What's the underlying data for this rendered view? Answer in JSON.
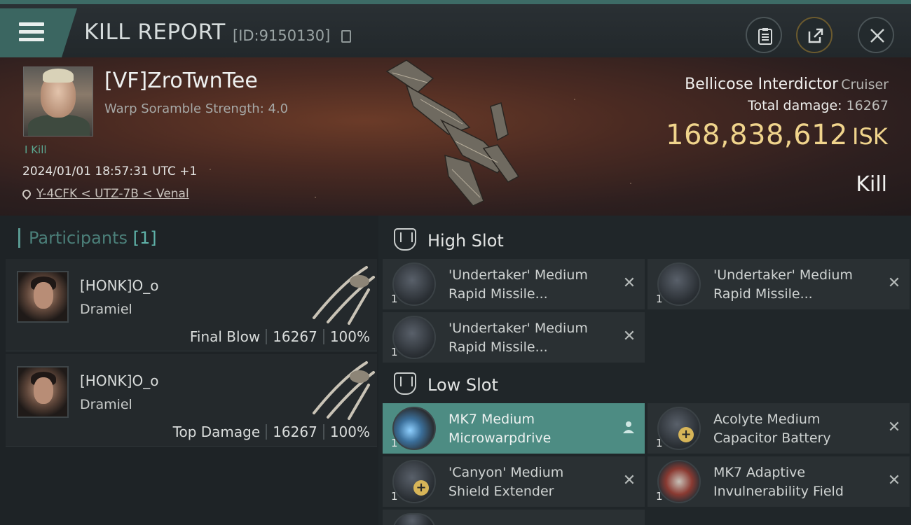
{
  "header": {
    "title": "KILL REPORT",
    "report_id": "[ID:9150130]"
  },
  "victim": {
    "name": "[VF]ZroTwnTee",
    "subtitle": "Warp Soramble Strength: 4.0",
    "kill_tag": "I Kill",
    "datetime": "2024/01/01 18:57:31 UTC +1",
    "location": "Y-4CFK < UTZ-7B < Venal",
    "ship_name": "Bellicose Interdictor",
    "ship_class": "Cruiser",
    "total_damage_label": "Total damage:",
    "total_damage": "16267",
    "isk_value": "168,838,612",
    "isk_unit": "ISK",
    "result": "Kill"
  },
  "participants": {
    "label": "Participants",
    "count": "[1]",
    "list": [
      {
        "name": "[HONK]O_o",
        "ship": "Dramiel",
        "role": "Final Blow",
        "damage": "16267",
        "percent": "100%"
      },
      {
        "name": "[HONK]O_o",
        "ship": "Dramiel",
        "role": "Top Damage",
        "damage": "16267",
        "percent": "100%"
      }
    ]
  },
  "fitting": {
    "high_slot_label": "High Slot",
    "low_slot_label": "Low Slot",
    "high_slot": [
      {
        "line1": "'Undertaker' Medium",
        "line2": "Rapid Missile...",
        "qty": "1"
      },
      {
        "line1": "'Undertaker' Medium",
        "line2": "Rapid Missile...",
        "qty": "1"
      },
      {
        "line1": "'Undertaker' Medium",
        "line2": "Rapid Missile...",
        "qty": "1"
      }
    ],
    "low_slot": [
      {
        "line1": "MK7 Medium",
        "line2": "Microwarpdrive",
        "qty": "1"
      },
      {
        "line1": "Acolyte Medium",
        "line2": "Capacitor Battery",
        "qty": "1"
      },
      {
        "line1": "'Canyon' Medium",
        "line2": "Shield Extender",
        "qty": "1"
      },
      {
        "line1": "MK7 Adaptive",
        "line2": "Invulnerability Field",
        "qty": "1"
      }
    ],
    "close_glyph": "✕"
  },
  "colors": {
    "accent": "#4d8c83",
    "isk": "#f0d48c",
    "banner": "#4a2a22"
  }
}
